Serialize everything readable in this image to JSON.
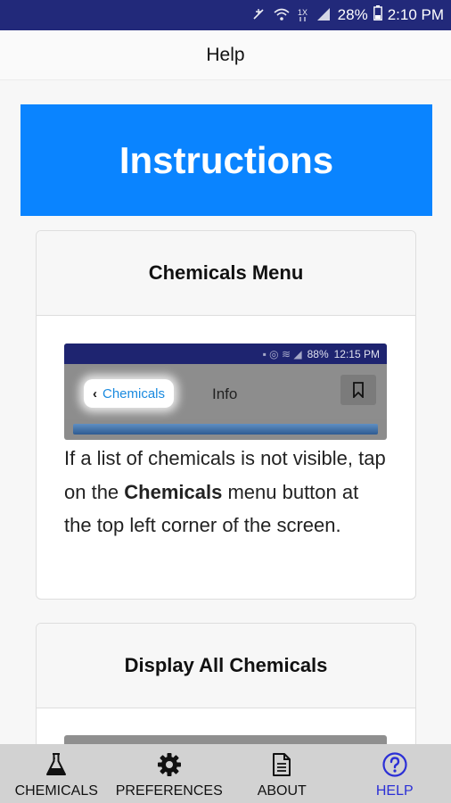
{
  "status_bar": {
    "battery": "28%",
    "time": "2:10 PM"
  },
  "header": {
    "title": "Help"
  },
  "banner": {
    "title": "Instructions"
  },
  "cards": [
    {
      "title": "Chemicals Menu",
      "screenshot": {
        "status_text": "88%",
        "time": "12:15 PM",
        "back_label": "Chemicals",
        "title": "Info"
      },
      "text_before": "If a list of chemicals is not visible, tap on the ",
      "text_bold": "Chemicals",
      "text_after": " menu button at the top left corner of the screen."
    },
    {
      "title": "Display All Chemicals"
    }
  ],
  "bottom_nav": {
    "items": [
      {
        "label": "CHEMICALS",
        "icon": "flask-icon"
      },
      {
        "label": "PREFERENCES",
        "icon": "gear-icon"
      },
      {
        "label": "ABOUT",
        "icon": "document-icon"
      },
      {
        "label": "HELP",
        "icon": "help-circle-icon"
      }
    ],
    "active": "HELP",
    "active_color": "#2b2fd6"
  },
  "colors": {
    "status_bar": "#22297a",
    "banner": "#0a84ff",
    "nav_background": "#d2d2d2"
  }
}
